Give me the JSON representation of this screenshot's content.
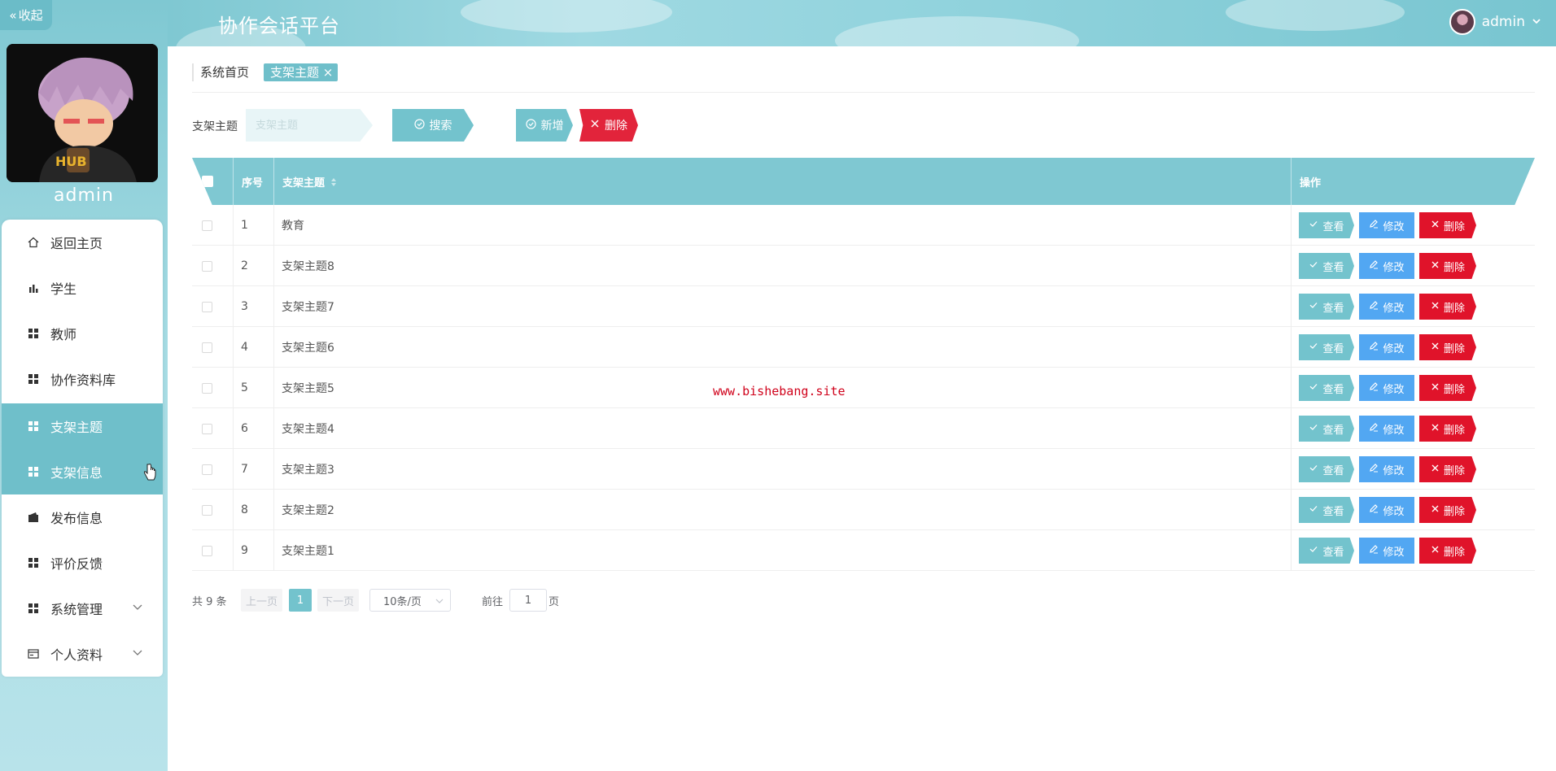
{
  "sidebar": {
    "collapse_label": "收起",
    "username": "admin",
    "items": [
      {
        "label": "返回主页",
        "icon": "home-icon"
      },
      {
        "label": "学生",
        "icon": "bar-chart-icon"
      },
      {
        "label": "教师",
        "icon": "grid-icon"
      },
      {
        "label": "协作资料库",
        "icon": "grid-icon"
      },
      {
        "label": "支架主题",
        "icon": "grid-icon",
        "active": true
      },
      {
        "label": "支架信息",
        "icon": "grid-icon",
        "active": true
      },
      {
        "label": "发布信息",
        "icon": "wallet-icon"
      },
      {
        "label": "评价反馈",
        "icon": "grid-icon"
      },
      {
        "label": "系统管理",
        "icon": "grid-icon",
        "expandable": true
      },
      {
        "label": "个人资料",
        "icon": "id-card-icon",
        "expandable": true
      }
    ]
  },
  "header": {
    "title": "协作会话平台",
    "user": "admin"
  },
  "breadcrumb": {
    "home": "系统首页",
    "current_tag": "支架主题",
    "close_symbol": "×"
  },
  "search": {
    "label": "支架主题",
    "placeholder": "支架主题",
    "search_button": "搜索",
    "add_button": "新增",
    "delete_button": "删除"
  },
  "table": {
    "columns": {
      "index": "序号",
      "topic": "支架主题",
      "actions": "操作"
    },
    "row_actions": {
      "view": "查看",
      "edit": "修改",
      "delete": "删除"
    },
    "rows": [
      {
        "index": "1",
        "topic": "教育"
      },
      {
        "index": "2",
        "topic": "支架主题8"
      },
      {
        "index": "3",
        "topic": "支架主题7"
      },
      {
        "index": "4",
        "topic": "支架主题6"
      },
      {
        "index": "5",
        "topic": "支架主题5"
      },
      {
        "index": "6",
        "topic": "支架主题4"
      },
      {
        "index": "7",
        "topic": "支架主题3"
      },
      {
        "index": "8",
        "topic": "支架主题2"
      },
      {
        "index": "9",
        "topic": "支架主题1"
      }
    ]
  },
  "pagination": {
    "total": "共 9 条",
    "prev": "上一页",
    "current_page": "1",
    "next": "下一页",
    "page_size": "10条/页",
    "goto_prefix": "前往",
    "goto_value": "1",
    "goto_suffix": "页"
  },
  "watermark": "www.bishebang.site",
  "colors": {
    "primary": "#73c3cd",
    "edit": "#52a7f2",
    "danger": "#e0132a"
  }
}
